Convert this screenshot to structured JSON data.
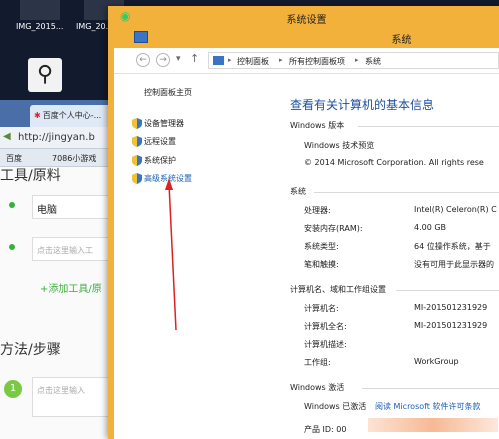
{
  "desktop": {
    "thumbs": [
      "IMG_2015...",
      "IMG_20..."
    ]
  },
  "browser": {
    "tab_title": "百度个人中心-...",
    "url": "http://jingyan.b",
    "bookmarks": [
      "百度",
      "7086小游戏"
    ],
    "tools_heading": "工具/原料",
    "tool_value": "电脑",
    "tool_placeholder": "点击这里输入工",
    "add_tool": "+添加工具/原",
    "steps_heading": "方法/步骤",
    "step_num": "1",
    "step_placeholder": "点击这里输入"
  },
  "window": {
    "outer_title": "系统设置",
    "inner_title": "系统",
    "nav_up": "↑",
    "breadcrumb": [
      "控制面板",
      "所有控制面板项",
      "系统"
    ]
  },
  "left_pane": {
    "home": "控制面板主页",
    "items": [
      "设备管理器",
      "远程设置",
      "系统保护",
      "高级系统设置"
    ]
  },
  "main": {
    "title": "查看有关计算机的基本信息",
    "edition_header": "Windows 版本",
    "edition_name": "Windows 技术预览",
    "copyright": "© 2014 Microsoft Corporation. All rights rese",
    "system_header": "系统",
    "system_rows": [
      {
        "label": "处理器:",
        "value": "Intel(R) Celeron(R) C"
      },
      {
        "label": "安装内存(RAM):",
        "value": "4.00 GB"
      },
      {
        "label": "系统类型:",
        "value": "64 位操作系统，基于"
      },
      {
        "label": "笔和触摸:",
        "value": "没有可用于此显示器的"
      }
    ],
    "computer_header": "计算机名、域和工作组设置",
    "computer_rows": [
      {
        "label": "计算机名:",
        "value": "MI-201501231929"
      },
      {
        "label": "计算机全名:",
        "value": "MI-201501231929"
      },
      {
        "label": "计算机描述:",
        "value": ""
      },
      {
        "label": "工作组:",
        "value": "WorkGroup"
      }
    ],
    "activation_header": "Windows 激活",
    "activation_status": "Windows 已激活",
    "activation_link": "阅读 Microsoft 软件许可条款",
    "product_id": "产品 ID: 00"
  },
  "colors": {
    "title_bar": "#f2b13b",
    "link": "#1a5fb4",
    "annotation_arrow": "#e02020"
  }
}
